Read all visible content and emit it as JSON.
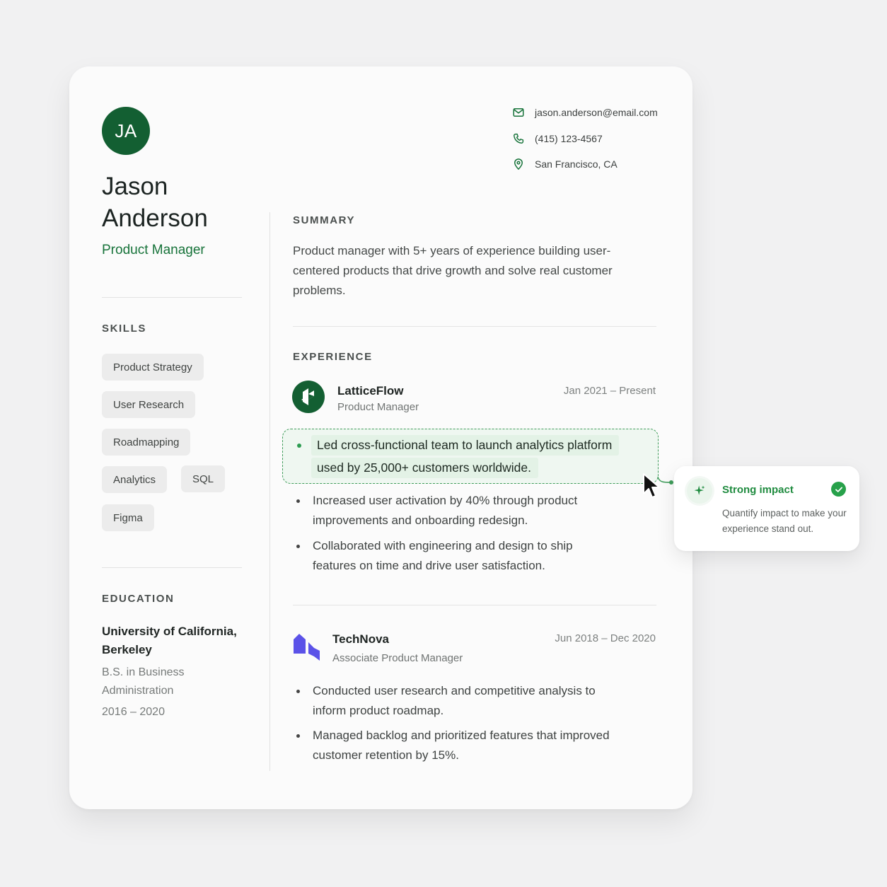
{
  "profile": {
    "initials": "JA",
    "first_name": "Jason",
    "last_name": "Anderson",
    "title": "Product Manager"
  },
  "contact": {
    "email": "jason.anderson@email.com",
    "phone": "(415) 123-4567",
    "location": "San Francisco, CA"
  },
  "skills": {
    "heading": "SKILLS",
    "items": [
      "Product Strategy",
      "User Research",
      "Roadmapping",
      "Analytics",
      "SQL",
      "Figma"
    ]
  },
  "education": {
    "heading": "EDUCATION",
    "school": "University of California, Berkeley",
    "degree": "B.S. in Business Administration",
    "years": "2016 – 2020"
  },
  "summary": {
    "heading": "SUMMARY",
    "text": "Product manager with 5+ years of experience building user-centered products that drive growth and solve real customer problems."
  },
  "experience": {
    "heading": "EXPERIENCE",
    "jobs": [
      {
        "company": "LatticeFlow",
        "position": "Product Manager",
        "dates": "Jan 2021 – Present",
        "highlighted_bullet": {
          "line1": "Led cross-functional team to launch analytics platform",
          "line2": "used by 25,000+ customers worldwide."
        },
        "bullets": [
          "Increased user activation by 40% through product improvements and onboarding redesign.",
          "Collaborated with engineering and design to ship features on time and drive user satisfaction."
        ]
      },
      {
        "company": "TechNova",
        "position": "Associate Product Manager",
        "dates": "Jun 2018 – Dec 2020",
        "bullets": [
          "Conducted user research and competitive analysis to inform product roadmap.",
          "Managed backlog and prioritized features that improved customer retention by 15%."
        ]
      }
    ]
  },
  "feedback": {
    "title": "Strong impact",
    "description": "Quantify impact to make your experience stand out.",
    "icon": "sparkle-icon"
  },
  "colors": {
    "brand_green": "#135f32",
    "accent_green": "#27a14a",
    "technova_purple": "#5b52e8"
  }
}
